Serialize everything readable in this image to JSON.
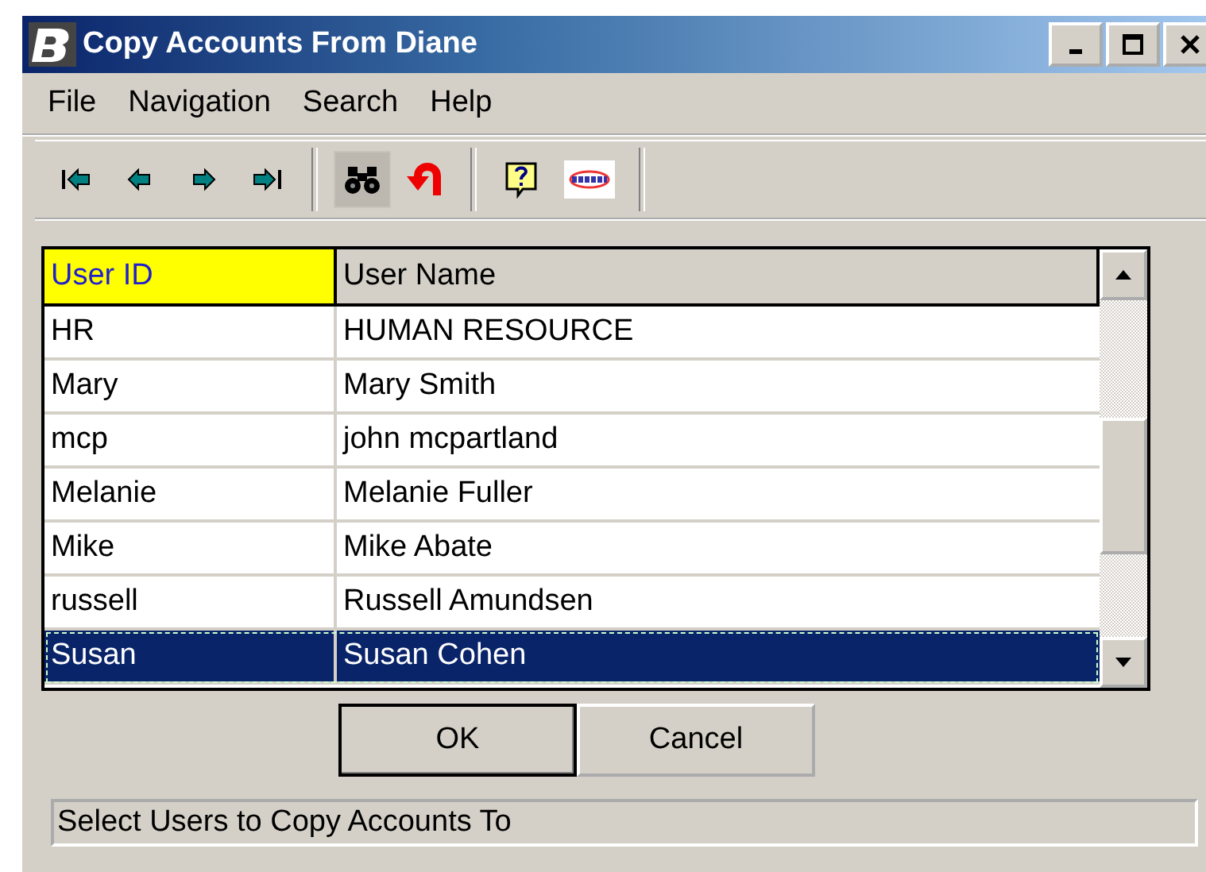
{
  "window": {
    "title": "Copy Accounts From Diane"
  },
  "menu": [
    "File",
    "Navigation",
    "Search",
    "Help"
  ],
  "toolbar": [
    {
      "kind": "first",
      "pressed": false
    },
    {
      "kind": "prev",
      "pressed": false
    },
    {
      "kind": "next",
      "pressed": false
    },
    {
      "kind": "last",
      "pressed": false
    },
    {
      "kind": "sep"
    },
    {
      "kind": "find",
      "pressed": true
    },
    {
      "kind": "undo",
      "pressed": false
    },
    {
      "kind": "sep"
    },
    {
      "kind": "help",
      "pressed": false
    },
    {
      "kind": "logo",
      "pressed": false
    },
    {
      "kind": "sep"
    }
  ],
  "table": {
    "columns": [
      {
        "label": "User ID",
        "highlighted": true
      },
      {
        "label": "User Name",
        "highlighted": false
      }
    ],
    "rows": [
      {
        "cells": [
          "HR",
          "HUMAN RESOURCE"
        ],
        "selected": false
      },
      {
        "cells": [
          "Mary",
          "Mary Smith"
        ],
        "selected": false
      },
      {
        "cells": [
          "mcp",
          "john mcpartland"
        ],
        "selected": false
      },
      {
        "cells": [
          "Melanie",
          "Melanie Fuller"
        ],
        "selected": false
      },
      {
        "cells": [
          "Mike",
          "Mike Abate"
        ],
        "selected": false
      },
      {
        "cells": [
          "russell",
          "Russell Amundsen"
        ],
        "selected": false
      },
      {
        "cells": [
          "Susan",
          "Susan Cohen"
        ],
        "selected": true
      }
    ]
  },
  "buttons": [
    {
      "label": "OK",
      "default": true
    },
    {
      "label": "Cancel",
      "default": false
    }
  ],
  "status_bar": "Select Users to Copy Accounts To"
}
